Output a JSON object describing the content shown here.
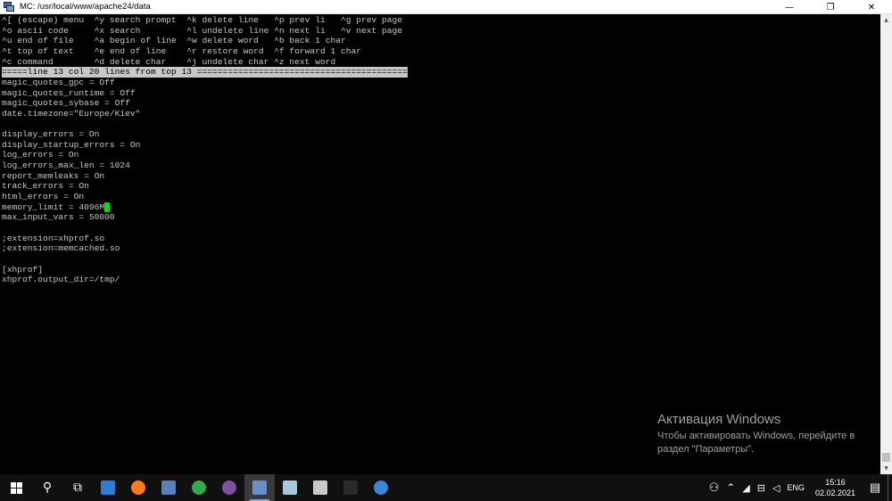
{
  "window": {
    "title": "MC: /usr/local/www/apache24/data",
    "minimize": "—",
    "maximize": "❐",
    "close": "✕"
  },
  "editor": {
    "help_lines": [
      "^[ (escape) menu  ^y search prompt  ^k delete line   ^p prev li   ^g prev page",
      "^o ascii code     ^x search         ^l undelete line ^n next li   ^v next page",
      "^u end of file    ^a begin of line  ^w delete word   ^b back 1 char",
      "^t top of text    ^e end of line    ^r restore word  ^f forward 1 char",
      "^c command        ^d delete char    ^j undelete char ^z next word"
    ],
    "status_line": "=====line 13 col 20 lines from top 13 =========================================",
    "content_lines": [
      "magic_quotes_gpc = Off",
      "magic_quotes_runtime = Off",
      "magic_quotes_sybase = Off",
      "date.timezone=\"Europe/Kiev\"",
      "",
      "display_errors = On",
      "display_startup_errors = On",
      "log_errors = On",
      "log_errors_max_len = 1024",
      "report_memleaks = On",
      "track_errors = On",
      "html_errors = On",
      "memory_limit = 4096M",
      "max_input_vars = 50000",
      "",
      ";extension=xhprof.so",
      ";extension=memcached.so",
      "",
      "[xhprof]",
      "xhprof.output_dir=/tmp/"
    ],
    "cursor_line": 12
  },
  "watermark": {
    "title": "Активация Windows",
    "text": "Чтобы активировать Windows, перейдите в раздел \"Параметры\"."
  },
  "taskbar": {
    "apps": [
      {
        "name": "start-icon",
        "kind": "start"
      },
      {
        "name": "search-icon",
        "kind": "glyph",
        "glyph": "⚲"
      },
      {
        "name": "task-view-icon",
        "kind": "glyph",
        "glyph": "⧉"
      },
      {
        "name": "remote-desktop-icon",
        "kind": "sq",
        "color": "#2e7bd6"
      },
      {
        "name": "firefox-icon",
        "kind": "circle",
        "color": "#ff7a1a"
      },
      {
        "name": "notepad-icon",
        "kind": "sq",
        "color": "#5b7fb8"
      },
      {
        "name": "chrome-icon",
        "kind": "circle",
        "color": "#34a853"
      },
      {
        "name": "viber-icon",
        "kind": "circle",
        "color": "#7b519d"
      },
      {
        "name": "putty-icon",
        "kind": "sq",
        "color": "#6a8fc8",
        "active": true
      },
      {
        "name": "app-icon",
        "kind": "sq",
        "color": "#a8c8d8"
      },
      {
        "name": "scanner-icon",
        "kind": "sq",
        "color": "#c8c8c8"
      },
      {
        "name": "terminal-icon",
        "kind": "sq",
        "color": "#2a2a2a"
      },
      {
        "name": "network-app-icon",
        "kind": "circle",
        "color": "#3a86d8"
      }
    ],
    "tray": {
      "people_glyph": "⚇",
      "chevron_glyph": "⌃",
      "wifi_glyph": "◢",
      "volume_glyph": "◁",
      "network_glyph": "⊟",
      "language": "ENG",
      "time": "15:16",
      "date": "02.02.2021",
      "notif_glyph": "▤"
    }
  }
}
